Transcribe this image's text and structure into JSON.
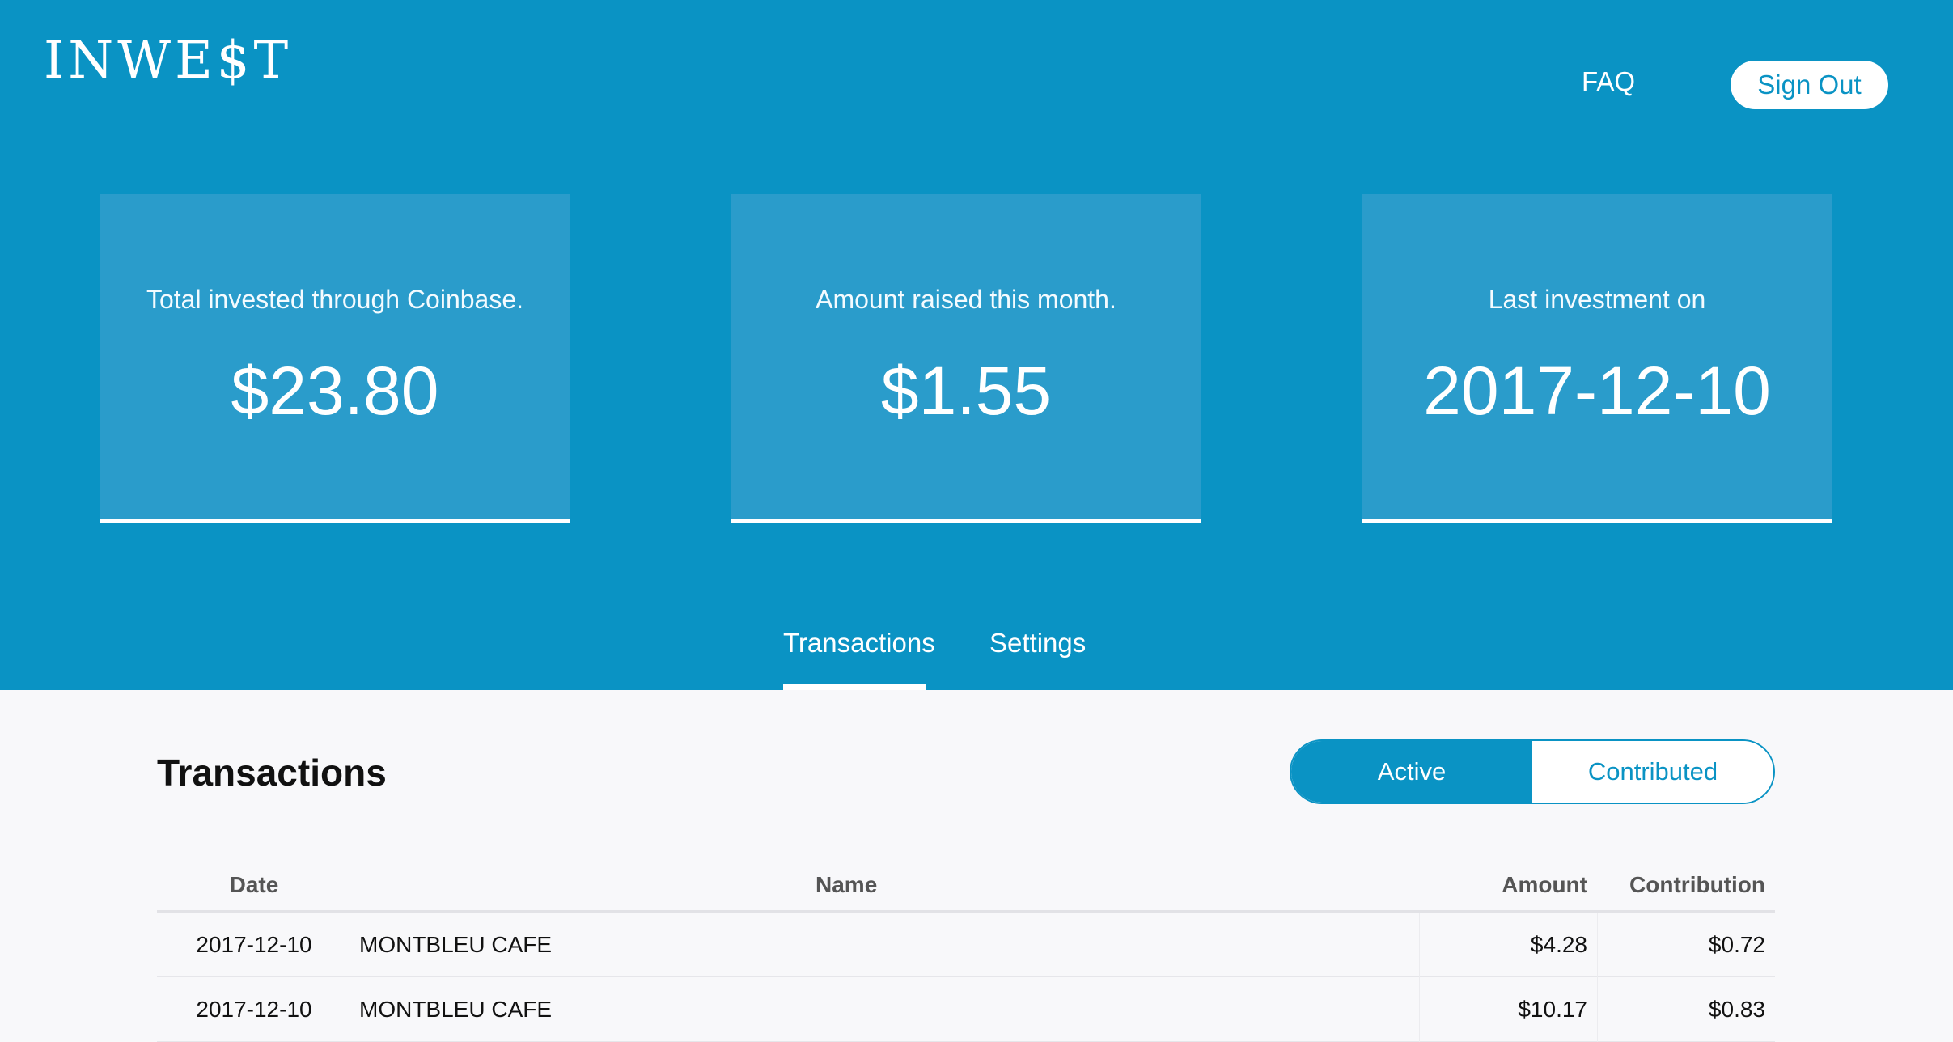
{
  "header": {
    "logo": "INWE$T",
    "faq_label": "FAQ",
    "signout_label": "Sign Out"
  },
  "cards": [
    {
      "label": "Total invested through Coinbase.",
      "value": "$23.80"
    },
    {
      "label": "Amount raised this month.",
      "value": "$1.55"
    },
    {
      "label": "Last investment on",
      "value": "2017-12-10"
    }
  ],
  "tabs": [
    {
      "label": "Transactions",
      "active": true
    },
    {
      "label": "Settings",
      "active": false
    }
  ],
  "section": {
    "title": "Transactions",
    "toggle": {
      "active_label": "Active",
      "inactive_label": "Contributed"
    }
  },
  "table": {
    "headers": {
      "date": "Date",
      "name": "Name",
      "amount": "Amount",
      "contribution": "Contribution"
    },
    "rows": [
      {
        "date": "2017-12-10",
        "name": "MONTBLEU CAFE",
        "amount": "$4.28",
        "contribution": "$0.72"
      },
      {
        "date": "2017-12-10",
        "name": "MONTBLEU CAFE",
        "amount": "$10.17",
        "contribution": "$0.83"
      }
    ]
  },
  "colors": {
    "brand": "#0a93c4",
    "card": "#2a9ccb",
    "page_background": "#f8f8fa"
  }
}
